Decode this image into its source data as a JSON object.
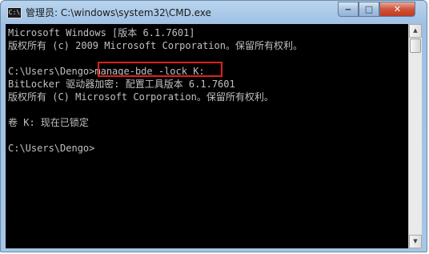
{
  "window": {
    "title": "管理员: C:\\windows\\system32\\CMD.exe",
    "icon": "cmd-icon",
    "controls": {
      "minimize_icon": "minimize-icon",
      "maximize_icon": "maximize-icon",
      "close_icon": "close-icon",
      "minimize_glyph": "‒",
      "maximize_glyph": "□",
      "close_glyph": "✕"
    }
  },
  "console": {
    "lines": [
      "Microsoft Windows [版本 6.1.7601]",
      "版权所有 (c) 2009 Microsoft Corporation。保留所有权利。",
      "",
      "C:\\Users\\Dengo>manage-bde -lock K:",
      "BitLocker 驱动器加密: 配置工具版本 6.1.7601",
      "版权所有 (C) Microsoft Corporation。保留所有权利。",
      "",
      "卷 K: 现在已锁定",
      "",
      "C:\\Users\\Dengo>"
    ],
    "highlighted_command": "manage-bde -lock K:",
    "colors": {
      "background": "#000000",
      "text": "#c0c0c0",
      "highlight_border": "#e02020"
    }
  },
  "scrollbar": {
    "up_glyph": "▲",
    "down_glyph": "▼"
  }
}
